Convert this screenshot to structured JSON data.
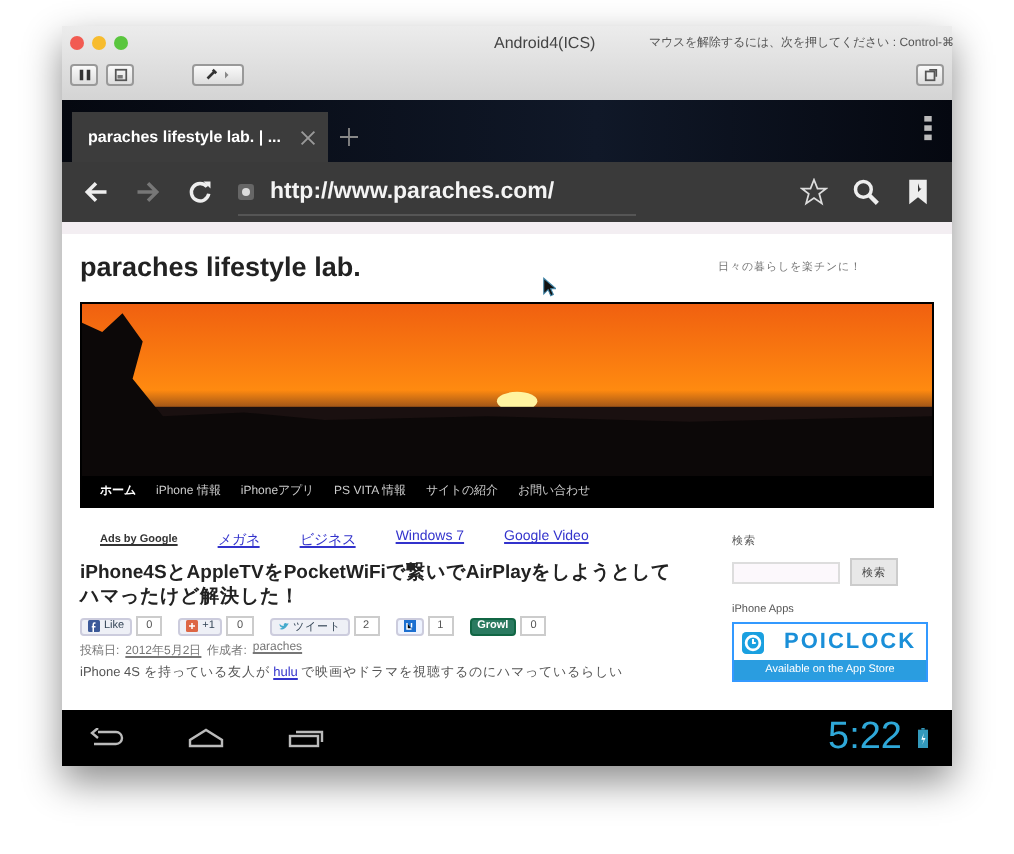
{
  "window": {
    "title": "Android4(ICS)",
    "hint": "マウスを解除するには、次を押してください : Control-⌘"
  },
  "browser": {
    "tabs": [
      {
        "label": "paraches lifestyle lab. | ...",
        "selected": true
      }
    ],
    "url": "http://www.paraches.com/"
  },
  "page": {
    "site_title": "paraches lifestyle lab.",
    "tagline": "日々の暮らしを楽チンに！",
    "nav": [
      {
        "label": "ホーム",
        "selected": true
      },
      {
        "label": "iPhone 情報",
        "selected": false
      },
      {
        "label": "iPhoneアプリ",
        "selected": false
      },
      {
        "label": "PS VITA 情報",
        "selected": false
      },
      {
        "label": "サイトの紹介",
        "selected": false
      },
      {
        "label": "お問い合わせ",
        "selected": false
      }
    ],
    "ads": {
      "label": "Ads by Google",
      "links": [
        "メガネ",
        "ビジネス",
        "Windows 7",
        "Google Video"
      ]
    },
    "post": {
      "title": "iPhone4SとAppleTVをPocketWiFiで繋いでAirPlayをしようとしてハマったけど解決した！",
      "share": [
        {
          "kind": "facebook",
          "label": "Like",
          "count": "0"
        },
        {
          "kind": "google",
          "label": "+1",
          "count": "0"
        },
        {
          "kind": "twitter",
          "label": "ツイート",
          "count": "2"
        },
        {
          "kind": "hatena",
          "count": "1"
        },
        {
          "kind": "growl",
          "label": "Growl",
          "count": "0"
        }
      ],
      "meta_posted": "投稿日:",
      "date": "2012年5月2日",
      "meta_author": "作成者:",
      "author": "paraches",
      "body": "iPhone 4S を持っている友人が **hulu** で映画やドラマを視聴するのにハマっているらしい"
    },
    "sidebar": {
      "search_label": "検索",
      "search_button": "検索",
      "apps_label": "iPhone Apps",
      "banner_title": "POICLOCK",
      "banner_subtitle": "Available on the App Store"
    }
  },
  "status_bar": {
    "time": "5:22"
  }
}
